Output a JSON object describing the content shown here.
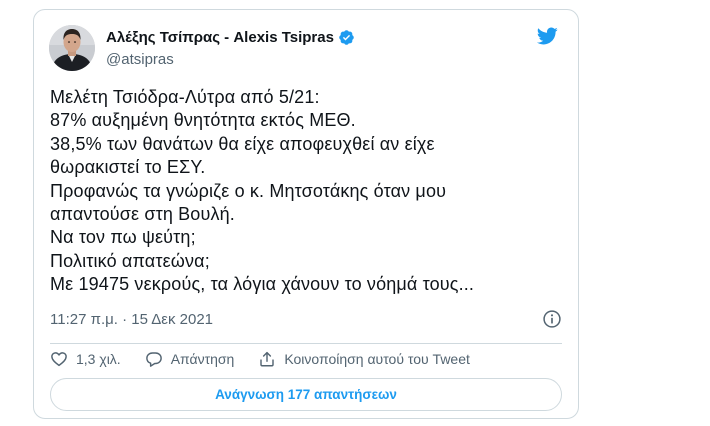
{
  "tweet": {
    "author": {
      "display_name": "Αλέξης Τσίπρας - Alexis Tsipras",
      "handle": "@atsipras",
      "verified": true,
      "avatar_icon": "profile-photo"
    },
    "text_lines": [
      "Μελέτη Τσιόδρα-Λύτρα από 5/21:",
      "87% αυξημένη θνητότητα εκτός ΜΕΘ.",
      "38,5% των θανάτων θα είχε αποφευχθεί αν είχε",
      "θωρακιστεί το ΕΣΥ.",
      "Προφανώς τα γνώριζε ο κ. Μητσοτάκης όταν μου",
      "απαντούσε στη Βουλή.",
      "Να τον πω ψεύτη;",
      "Πολιτικό απατεώνα;",
      "Με 19475 νεκρούς, τα λόγια χάνουν το νόημά τους..."
    ],
    "timestamp": "11:27 π.μ. · 15 Δεκ 2021"
  },
  "actions": {
    "like_count": "1,3 χιλ.",
    "reply_label": "Απάντηση",
    "share_label": "Κοινοποίηση αυτού του Tweet"
  },
  "read_replies_label": "Ανάγνωση 177 απαντήσεων",
  "colors": {
    "accent": "#1d9bf0",
    "text": "#0f1419",
    "secondary": "#536471",
    "border": "#cfd9de"
  }
}
